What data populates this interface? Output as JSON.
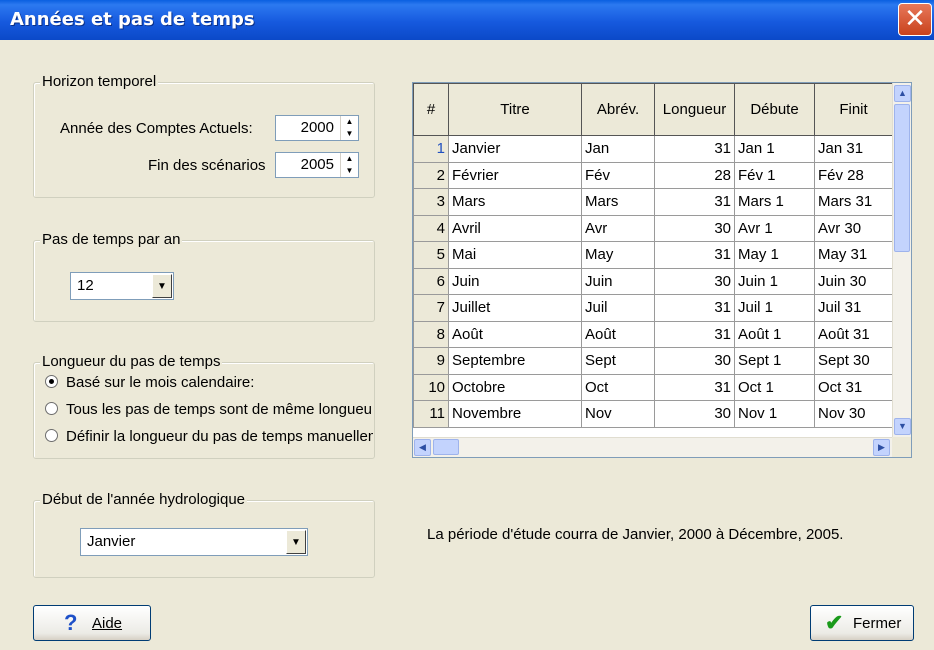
{
  "window": {
    "title": "Années et pas de temps",
    "close_glyph": "✕"
  },
  "horizon": {
    "legend": "Horizon temporel",
    "base_year_label": "Année des Comptes Actuels:",
    "base_year": "2000",
    "end_label": "Fin des scénarios",
    "end_year": "2005"
  },
  "steps": {
    "legend": "Pas de temps par an",
    "value": "12"
  },
  "length": {
    "legend": "Longueur du pas de temps",
    "options": [
      "Basé sur le mois calendaire:",
      "Tous les pas de temps sont de même longueur",
      "Définir la longueur du pas de temps manuellement"
    ],
    "selected_index": 0
  },
  "hydro": {
    "legend": "Début de l'année hydrologique",
    "value": "Janvier"
  },
  "table": {
    "headers": [
      "#",
      "Titre",
      "Abrév.",
      "Longueur",
      "Débute",
      "Finit"
    ],
    "rows": [
      [
        "1",
        "Janvier",
        "Jan",
        "31",
        "Jan 1",
        "Jan 31"
      ],
      [
        "2",
        "Février",
        "Fév",
        "28",
        "Fév 1",
        "Fév 28"
      ],
      [
        "3",
        "Mars",
        "Mars",
        "31",
        "Mars 1",
        "Mars 31"
      ],
      [
        "4",
        "Avril",
        "Avr",
        "30",
        "Avr 1",
        "Avr 30"
      ],
      [
        "5",
        "Mai",
        "May",
        "31",
        "May 1",
        "May 31"
      ],
      [
        "6",
        "Juin",
        "Juin",
        "30",
        "Juin 1",
        "Juin 30"
      ],
      [
        "7",
        "Juillet",
        "Juil",
        "31",
        "Juil 1",
        "Juil 31"
      ],
      [
        "8",
        "Août",
        "Août",
        "31",
        "Août 1",
        "Août 31"
      ],
      [
        "9",
        "Septembre",
        "Sept",
        "30",
        "Sept 1",
        "Sept 30"
      ],
      [
        "10",
        "Octobre",
        "Oct",
        "31",
        "Oct 1",
        "Oct 31"
      ],
      [
        "11",
        "Novembre",
        "Nov",
        "30",
        "Nov 1",
        "Nov 30"
      ]
    ]
  },
  "summary": "La période d'étude courra de Janvier, 2000 à Décembre, 2005.",
  "buttons": {
    "help": "Aide",
    "close": "Fermer"
  },
  "colors": {
    "titlebar": "#0b49c8",
    "dialog_bg": "#ece9d8",
    "help_icon": "#1e50c8",
    "ok_icon": "#1a9a1a"
  }
}
